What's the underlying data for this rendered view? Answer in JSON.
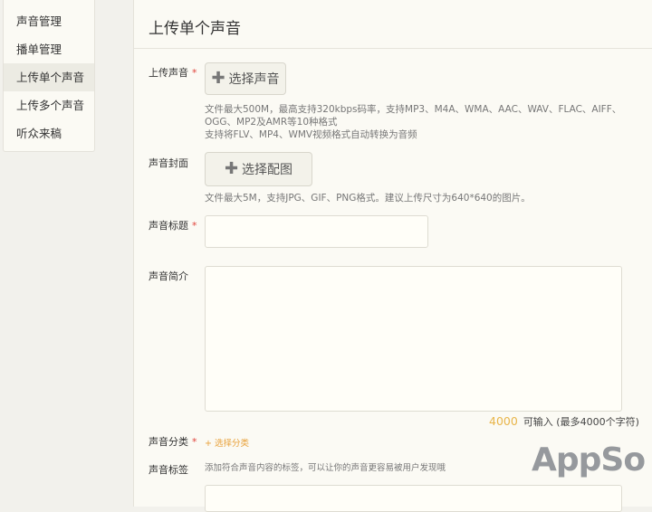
{
  "sidebar": {
    "items": [
      {
        "label": "声音管理",
        "active": false
      },
      {
        "label": "播单管理",
        "active": false
      },
      {
        "label": "上传单个声音",
        "active": true
      },
      {
        "label": "上传多个声音",
        "active": false
      },
      {
        "label": "听众来稿",
        "active": false
      }
    ]
  },
  "main": {
    "title": "上传单个声音",
    "upload_audio": {
      "label": "上传声音",
      "required_mark": "*",
      "button_label": "选择声音",
      "hint_line1": "文件最大500M，最高支持320kbps码率，支持MP3、M4A、WMA、AAC、WAV、FLAC、AIFF、OGG、MP2及AMR等10种格式",
      "hint_line2": "支持将FLV、MP4、WMV视频格式自动转换为音频"
    },
    "cover": {
      "label": "声音封面",
      "button_label": "选择配图",
      "hint": "文件最大5M，支持JPG、GIF、PNG格式。建议上传尺寸为640*640的图片。"
    },
    "title_field": {
      "label": "声音标题",
      "required_mark": "*",
      "value": ""
    },
    "intro": {
      "label": "声音简介",
      "value": "",
      "counter_value": "4000",
      "counter_text": "可输入 (最多4000个字符)"
    },
    "category": {
      "label": "声音分类",
      "required_mark": "*",
      "link_label": "+ 选择分类"
    },
    "tags": {
      "label": "声音标签",
      "hint": "添加符合声音内容的标签，可以让你的声音更容易被用户发现哦"
    }
  },
  "watermark": {
    "text": "AppSo"
  },
  "colors": {
    "accent": "#e8a13a",
    "required": "#e0443c",
    "panel": "#fbfaf4",
    "background": "#f2f1ec"
  }
}
